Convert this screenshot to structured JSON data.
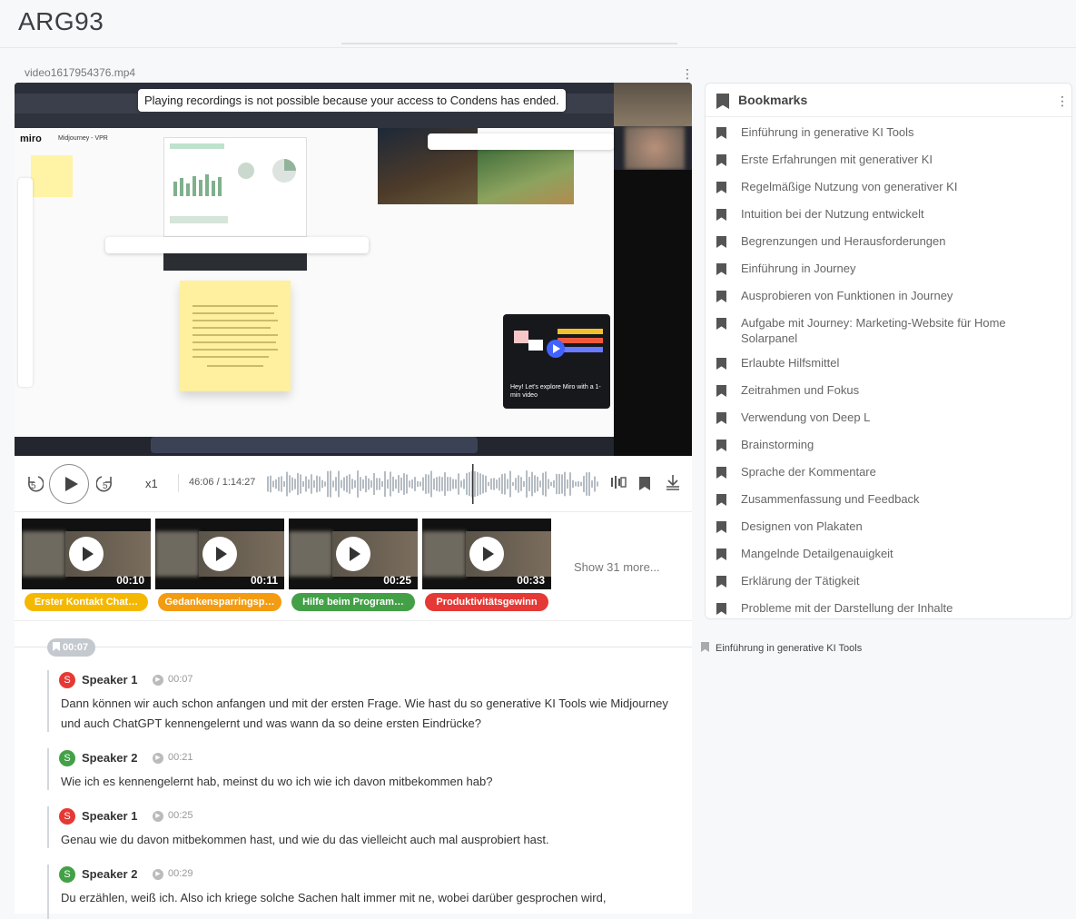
{
  "page": {
    "title": "ARG93"
  },
  "video": {
    "filename": "video1617954376.mp4",
    "notice": "Playing recordings is not possible because your access to Condens has ended.",
    "screen": {
      "app_name": "miro",
      "board_name": "Midjourney - VPR",
      "explore_text": "Hey! Let's explore Miro with a 1-min video"
    }
  },
  "player": {
    "rewind_seconds": "5",
    "forward_seconds": "5",
    "speed": "x1",
    "time": "46:06 / 1:14:27"
  },
  "clips": {
    "items": [
      {
        "duration": "00:10",
        "tag": "Erster Kontakt Chat…",
        "color": "#f5b800"
      },
      {
        "duration": "00:11",
        "tag": "Gedankensparringsp…",
        "color": "#f39c12"
      },
      {
        "duration": "00:25",
        "tag": "Hilfe beim Program…",
        "color": "#43a047"
      },
      {
        "duration": "00:33",
        "tag": "Produktivitätsgewinn",
        "color": "#e53935"
      }
    ],
    "show_more": "Show 31 more..."
  },
  "transcript": {
    "section_time": "00:07",
    "utterances": [
      {
        "initial": "S",
        "speaker": "Speaker 1",
        "time": "00:07",
        "color": "#e53935",
        "text": "Dann können wir auch schon anfangen und mit der ersten Frage. Wie hast du so generative KI Tools wie Midjourney und auch ChatGPT kennengelernt und was wann da so deine ersten Eindrücke?"
      },
      {
        "initial": "S",
        "speaker": "Speaker 2",
        "time": "00:21",
        "color": "#43a047",
        "text": "Wie ich es kennengelernt hab, meinst du wo ich wie ich davon mitbekommen hab?"
      },
      {
        "initial": "S",
        "speaker": "Speaker 1",
        "time": "00:25",
        "color": "#e53935",
        "text": "Genau wie du davon mitbekommen hast, und wie du das vielleicht auch mal ausprobiert hast."
      },
      {
        "initial": "S",
        "speaker": "Speaker 2",
        "time": "00:29",
        "color": "#43a047",
        "text": "Du erzählen, weiß ich. Also ich kriege solche Sachen halt immer mit ne, wobei darüber gesprochen wird,"
      }
    ]
  },
  "bookmarks": {
    "title": "Bookmarks",
    "items": [
      "Einführung in generative KI Tools",
      "Erste Erfahrungen mit generativer KI",
      "Regelmäßige Nutzung von generativer KI",
      "Intuition bei der Nutzung entwickelt",
      "Begrenzungen und Herausforderungen",
      "Einführung in Journey",
      "Ausprobieren von Funktionen in Journey",
      "Aufgabe mit Journey: Marketing-Website für Home Solarpanel",
      "Erlaubte Hilfsmittel",
      "Zeitrahmen und Fokus",
      "Verwendung von Deep L",
      "Brainstorming",
      "Sprache der Kommentare",
      "Zusammenfassung und Feedback",
      "Designen von Plakaten",
      "Mangelnde Detailgenauigkeit",
      "Erklärung der Tätigkeit",
      "Probleme mit der Darstellung der Inhalte"
    ],
    "current": "Einführung in generative KI Tools"
  }
}
